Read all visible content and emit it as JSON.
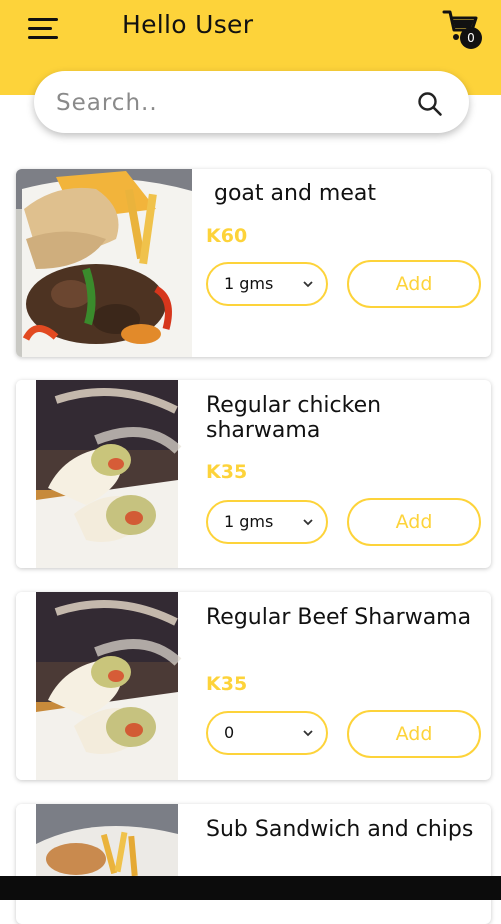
{
  "header": {
    "title": "Hello User",
    "cart_count": "0",
    "brand_color": "#fdd33a"
  },
  "search": {
    "placeholder": "Search.."
  },
  "products": [
    {
      "name": "goat and meat",
      "price": "K60",
      "quantity": "1 gms",
      "add_label": "Add"
    },
    {
      "name": "Regular chicken sharwama",
      "price": "K35",
      "quantity": "1 gms",
      "add_label": "Add"
    },
    {
      "name": "Regular Beef Sharwama",
      "price": "K35",
      "quantity": "0",
      "add_label": "Add"
    },
    {
      "name": "Sub Sandwich and chips"
    }
  ],
  "icons": {
    "menu": "menu-icon",
    "cart": "cart-icon",
    "search": "search-icon",
    "chevron": "chevron-down-icon"
  }
}
